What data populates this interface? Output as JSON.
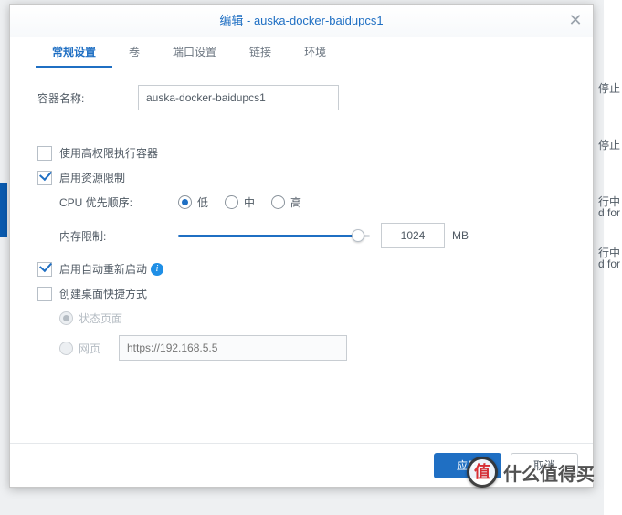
{
  "bg": {
    "t1": "停止",
    "t2": "停止",
    "t3": "行中",
    "t4": "d for",
    "t5": "行中",
    "t6": "d for"
  },
  "dialog": {
    "title": "编辑 - auska-docker-baidupcs1",
    "close": "✕",
    "tabs": [
      "常规设置",
      "卷",
      "端口设置",
      "链接",
      "环境"
    ],
    "activeTab": 0,
    "nameLabel": "容器名称:",
    "nameValue": "auska-docker-baidupcs1",
    "privLabel": "使用高权限执行容器",
    "privChecked": false,
    "resLabel": "启用资源限制",
    "resChecked": true,
    "cpuLabel": "CPU 优先顺序:",
    "cpuOptions": [
      "低",
      "中",
      "高"
    ],
    "cpuSelected": 0,
    "memLabel": "内存限制:",
    "memValue": "1024",
    "memUnit": "MB",
    "autoLabel": "启用自动重新启动",
    "autoChecked": true,
    "shortcutLabel": "创建桌面快捷方式",
    "shortcutChecked": false,
    "shortcutOpts": [
      "状态页面",
      "网页"
    ],
    "shortcutSel": 0,
    "urlPlaceholder": "https://192.168.5.5",
    "applyBtn": "应用",
    "cancelBtn": "取消"
  },
  "watermark": {
    "badge": "值",
    "text": "什么值得买"
  }
}
